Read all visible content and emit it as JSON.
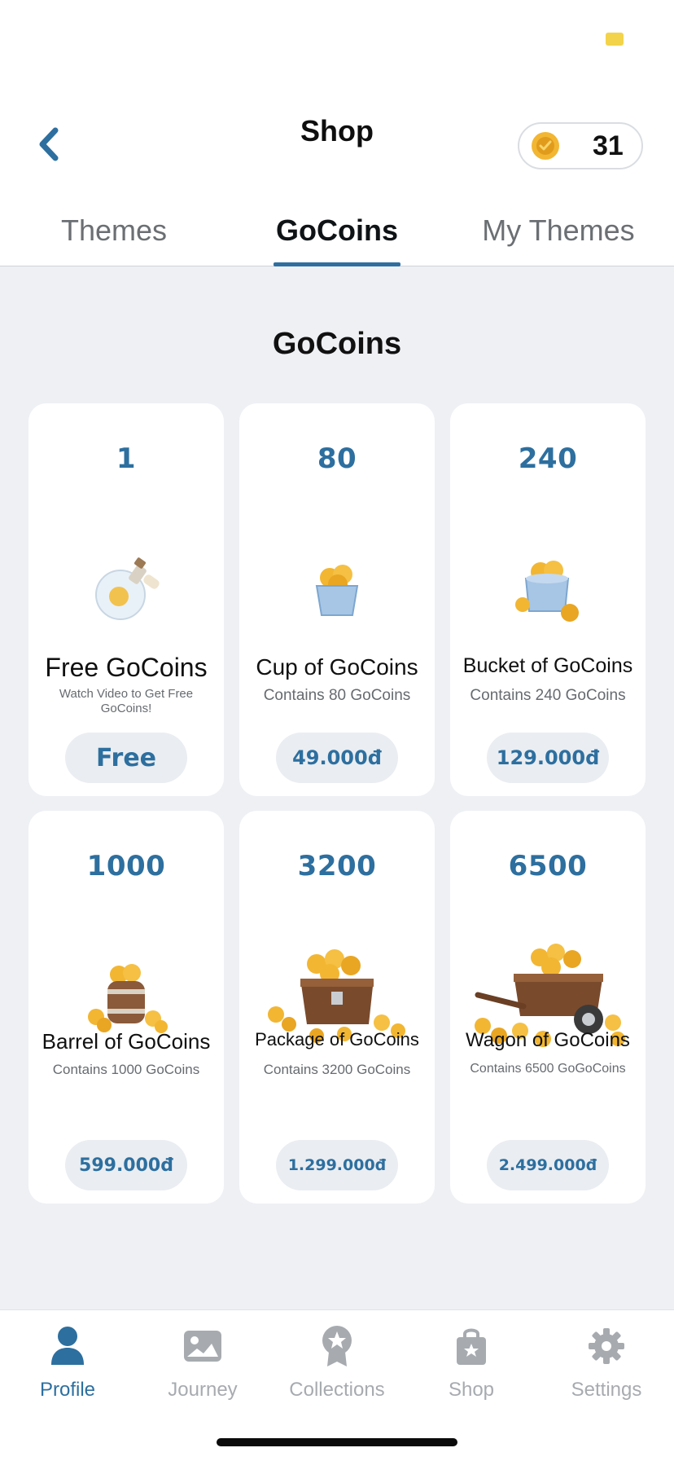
{
  "header": {
    "title": "Shop",
    "coin_count": "31"
  },
  "tabs": [
    {
      "label": "Themes"
    },
    {
      "label": "GoCoins"
    },
    {
      "label": "My Themes"
    }
  ],
  "section_title": "GoCoins",
  "products": [
    {
      "amount": "1",
      "name": "Free GoCoins",
      "desc": "Watch Video to Get Free GoCoins!",
      "price": "Free",
      "icon": "potion-bottle-coin-icon"
    },
    {
      "amount": "80",
      "name": "Cup of GoCoins",
      "desc": "Contains 80 GoCoins",
      "price": "49.000đ",
      "icon": "cup-of-coins-icon"
    },
    {
      "amount": "240",
      "name": "Bucket of GoCoins",
      "desc": "Contains 240 GoCoins",
      "price": "129.000đ",
      "icon": "bucket-of-coins-icon"
    },
    {
      "amount": "1000",
      "name": "Barrel of GoCoins",
      "desc": "Contains 1000 GoCoins",
      "price": "599.000đ",
      "icon": "barrel-of-coins-icon"
    },
    {
      "amount": "3200",
      "name": "Package of GoCoins",
      "desc": "Contains 3200 GoCoins",
      "price": "1.299.000đ",
      "icon": "treasure-chest-coins-icon"
    },
    {
      "amount": "6500",
      "name": "Wagon of GoCoins",
      "desc": "Contains 6500 GoGoCoins",
      "price": "2.499.000đ",
      "icon": "wagon-of-coins-icon"
    }
  ],
  "nav": [
    {
      "label": "Profile",
      "icon": "person-icon",
      "active": true
    },
    {
      "label": "Journey",
      "icon": "image-icon",
      "active": false
    },
    {
      "label": "Collections",
      "icon": "award-ribbon-icon",
      "active": false
    },
    {
      "label": "Shop",
      "icon": "shopping-bag-icon",
      "active": false
    },
    {
      "label": "Settings",
      "icon": "gear-icon",
      "active": false
    }
  ],
  "colors": {
    "accent": "#2d6f9f",
    "background": "#eef0f4",
    "coin": "#f2b632"
  }
}
